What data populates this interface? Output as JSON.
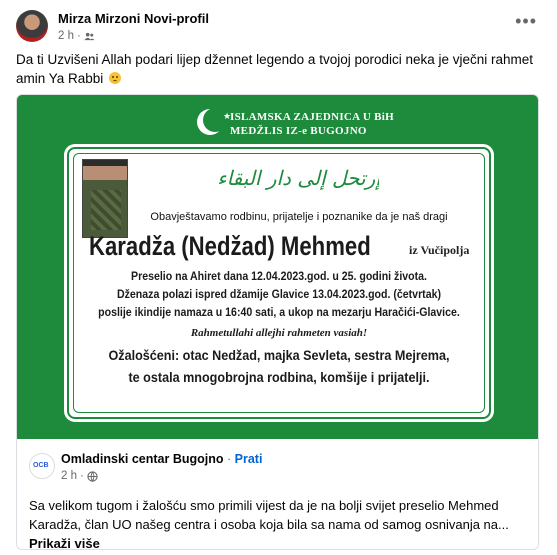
{
  "post": {
    "author": "Mirza Mirzoni Novi-profil",
    "time": "2 h",
    "audience_icon": "friends-icon",
    "more_icon": "more-options-icon",
    "more_label": "•••",
    "text": "Da ti Uzvišeni Allah podari lijep džennet legendo a tvojoj porodici neka je vječni rahmet amin Ya Rabbi",
    "emoji": "sad-face-emoji"
  },
  "obituary": {
    "org_line1": "ISLAMSKA ZAJEDNICA U BiH",
    "org_line2": "MEDŽLIS IZ-e BUGOJNO",
    "arabic": "إرتحل إلى دار البقاء",
    "intro": "Obavještavamo rodbinu, prijatelje i poznanike da je naš dragi",
    "deceased": "Karadža (Nedžad) Mehmed",
    "origin": "iz Vučipolja",
    "line1": "Preselio na Ahiret dana 12.04.2023.god. u 25. godini života.",
    "line2": "Dženaza polazi ispred džamije Glavice 13.04.2023.god. (četvrtak)",
    "line3": "poslije ikindije namaza u 16:40 sati, a ukop na mezarju Haračići-Glavice.",
    "rahmet": "Rahmetullahi allejhi rahmeten vasiah!",
    "mourners1": "Ožalošćeni: otac Nedžad, majka Sevleta, sestra Mejrema,",
    "mourners2": "te ostala mnogobrojna rodbina, komšije i prijatelji."
  },
  "shared": {
    "page_name": "Omladinski centar Bugojno",
    "separator": " · ",
    "follow_label": "Prati",
    "time": "2 h",
    "audience_icon": "globe-icon",
    "text": "Sa velikom tugom i žalošću smo primili vijest da je na bolji svijet preselio Mehmed Karadža, član UO našeg centra i osoba koja bila sa nama od samog osnivanja na...",
    "see_more_label": "Prikaži više"
  },
  "colors": {
    "obituary_green": "#1e8a3c",
    "link_blue": "#0064d1",
    "meta_gray": "#65676b"
  }
}
